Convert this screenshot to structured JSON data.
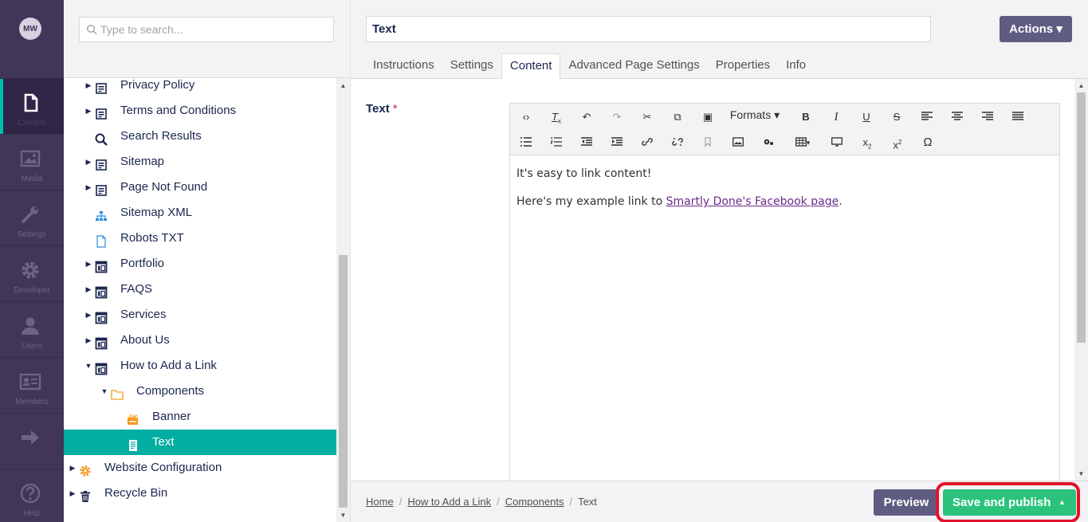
{
  "user": {
    "initials": "MW"
  },
  "sections": [
    {
      "label": "Content",
      "icon": "document-icon",
      "active": true
    },
    {
      "label": "Media",
      "icon": "image-icon"
    },
    {
      "label": "Settings",
      "icon": "wrench-icon"
    },
    {
      "label": "Developer",
      "icon": "gear-icon"
    },
    {
      "label": "Users",
      "icon": "user-icon"
    },
    {
      "label": "Members",
      "icon": "id-card-icon"
    },
    {
      "label": "",
      "icon": "arrow-right-icon"
    },
    {
      "label": "Help",
      "icon": "help-icon"
    }
  ],
  "search": {
    "placeholder": "Type to search..."
  },
  "tree": [
    {
      "label": "Privacy Policy",
      "icon": "page-icon",
      "caret": "collapsed"
    },
    {
      "label": "Terms and Conditions",
      "icon": "page-icon",
      "caret": "collapsed"
    },
    {
      "label": "Search Results",
      "icon": "search-icon",
      "caret": "none"
    },
    {
      "label": "Sitemap",
      "icon": "page-icon",
      "caret": "collapsed"
    },
    {
      "label": "Page Not Found",
      "icon": "page-icon",
      "caret": "collapsed"
    },
    {
      "label": "Sitemap XML",
      "icon": "sitemap-icon",
      "caret": "none"
    },
    {
      "label": "Robots TXT",
      "icon": "file-icon",
      "caret": "none"
    },
    {
      "label": "Portfolio",
      "icon": "layout-icon",
      "caret": "collapsed"
    },
    {
      "label": "FAQS",
      "icon": "layout-icon",
      "caret": "collapsed"
    },
    {
      "label": "Services",
      "icon": "layout-icon",
      "caret": "collapsed"
    },
    {
      "label": "About Us",
      "icon": "layout-icon",
      "caret": "collapsed"
    },
    {
      "label": "How to Add a Link",
      "icon": "layout-icon",
      "caret": "expanded"
    },
    {
      "label": "Components",
      "icon": "folder-icon",
      "caret": "expanded"
    },
    {
      "label": "Banner",
      "icon": "banner-icon",
      "caret": "none"
    },
    {
      "label": "Text",
      "icon": "text-doc-icon",
      "caret": "none",
      "selected": true
    },
    {
      "label": "Website Configuration",
      "icon": "cog-icon",
      "caret": "collapsed"
    },
    {
      "label": "Recycle Bin",
      "icon": "trash-icon",
      "caret": "collapsed"
    }
  ],
  "editor": {
    "name": "Text",
    "actions_label": "Actions ▾",
    "tabs": [
      "Instructions",
      "Settings",
      "Content",
      "Advanced Page Settings",
      "Properties",
      "Info"
    ],
    "active_tab": "Content",
    "property_label": "Text",
    "required_mark": "*",
    "formats_label": "Formats",
    "paragraph1": "It's easy to link content!",
    "paragraph2_prefix": "Here's my example link to ",
    "link_text": "Smartly Done's Facebook page",
    "paragraph2_suffix": "."
  },
  "breadcrumb": [
    "Home",
    "How to Add a Link",
    "Components",
    "Text"
  ],
  "footer": {
    "preview_label": "Preview",
    "publish_label": "Save and publish"
  },
  "colors": {
    "nav_bg": "#413659",
    "accent": "#00aea2",
    "publish": "#2bc37c",
    "highlight": "#e4112a",
    "button": "#5f5c82"
  }
}
